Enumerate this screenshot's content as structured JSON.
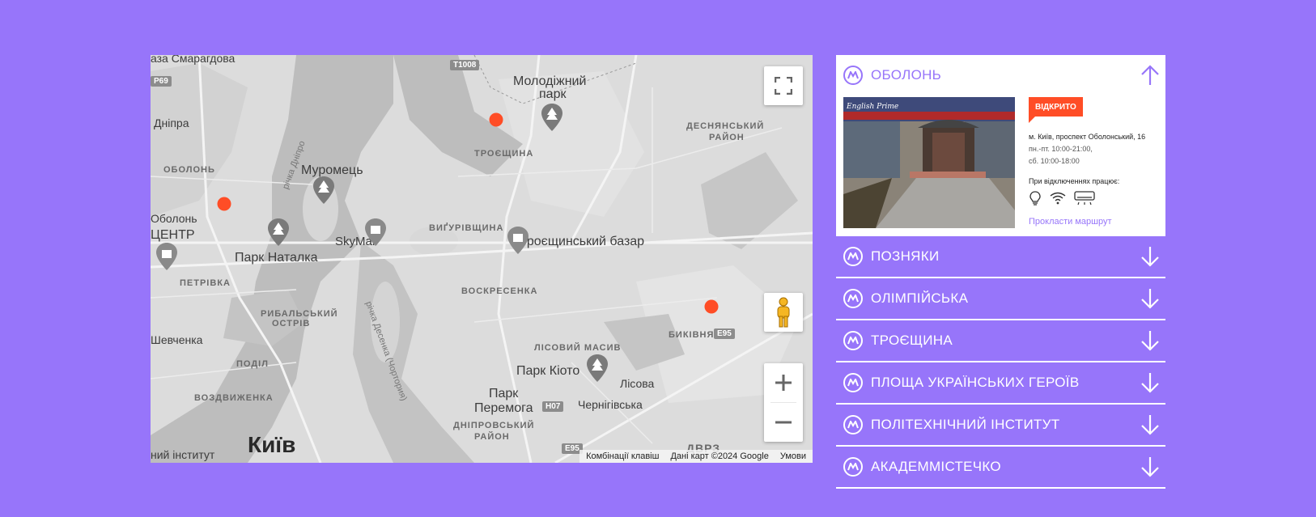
{
  "map": {
    "districts": [
      {
        "text": "ОБОЛОНЬ"
      },
      {
        "text": "ТРОЄЩИНА"
      },
      {
        "text": "ДЕСНЯНСЬКИЙ"
      },
      {
        "text": "РАЙОН"
      },
      {
        "text": "ВИҐУРІВЩИНА"
      },
      {
        "text": "ПЕТРІВКА"
      },
      {
        "text": "ВОСКРЕСЕНКА"
      },
      {
        "text": "РИБАЛЬСЬКИЙ"
      },
      {
        "text": "ОСТРІВ"
      },
      {
        "text": "ЛІСОВИЙ МАСИВ"
      },
      {
        "text": "БИКІВНЯ"
      },
      {
        "text": "ПОДІЛ"
      },
      {
        "text": "ВОЗДВИЖЕНКА"
      },
      {
        "text": "ДНІПРОВСЬКИЙ"
      },
      {
        "text": "РАЙОН"
      },
      {
        "text": "ДВРЗ"
      }
    ],
    "places": [
      {
        "text": "Молодіжний"
      },
      {
        "text": "парк"
      },
      {
        "text": "Муромець"
      },
      {
        "text": "SkyMall"
      },
      {
        "text": "Троєщинський базар"
      },
      {
        "text": "Парк Наталка"
      },
      {
        "text": "Парк Кіото"
      },
      {
        "text": "Парк"
      },
      {
        "text": "Перемога"
      },
      {
        "text": "Лісова"
      },
      {
        "text": "Чернігівська"
      },
      {
        "text": "Дніпра"
      },
      {
        "text": "Оболонь"
      },
      {
        "text": "ЦЕНТР"
      },
      {
        "text": "Шевченка"
      },
      {
        "text": "аза Смарагдова"
      },
      {
        "text": "ний інститут"
      }
    ],
    "city": "Київ",
    "rivers": [
      "річка Дніпро",
      "річка Десенка (Чортория)"
    ],
    "roads": [
      "T1008",
      "P69",
      "E95",
      "H07",
      "E95"
    ],
    "attribution": {
      "shortcuts": "Комбінації клавіш",
      "data": "Дані карт ©2024 Google",
      "terms": "Умови"
    },
    "marker_color": "#ff4d26"
  },
  "accordion": {
    "accent_color": "#9775fa",
    "open_item": {
      "title": "ОБОЛОНЬ",
      "badge": "ВІДКРИТО",
      "photo_sign": "English Prime",
      "address": "м. Київ, проспект Оболонський, 16",
      "hours_weekdays": "пн.-пт. 10:00-21:00,",
      "hours_saturday": "сб. 10:00-18:00",
      "backup_label": "При відключеннях працює:",
      "amenities": [
        "lightbulb-icon",
        "wifi-icon",
        "air-conditioner-icon"
      ],
      "route_link": "Прокласти маршрут"
    },
    "items": [
      {
        "title": "ПОЗНЯКИ"
      },
      {
        "title": "ОЛІМПІЙСЬКА"
      },
      {
        "title": "ТРОЄЩИНА"
      },
      {
        "title": "ПЛОЩА УКРАЇНСЬКИХ ГЕРОЇВ"
      },
      {
        "title": "ПОЛІТЕХНІЧНИЙ ІНСТИТУТ"
      },
      {
        "title": "АКАДЕММІСТЕЧКО"
      }
    ]
  }
}
